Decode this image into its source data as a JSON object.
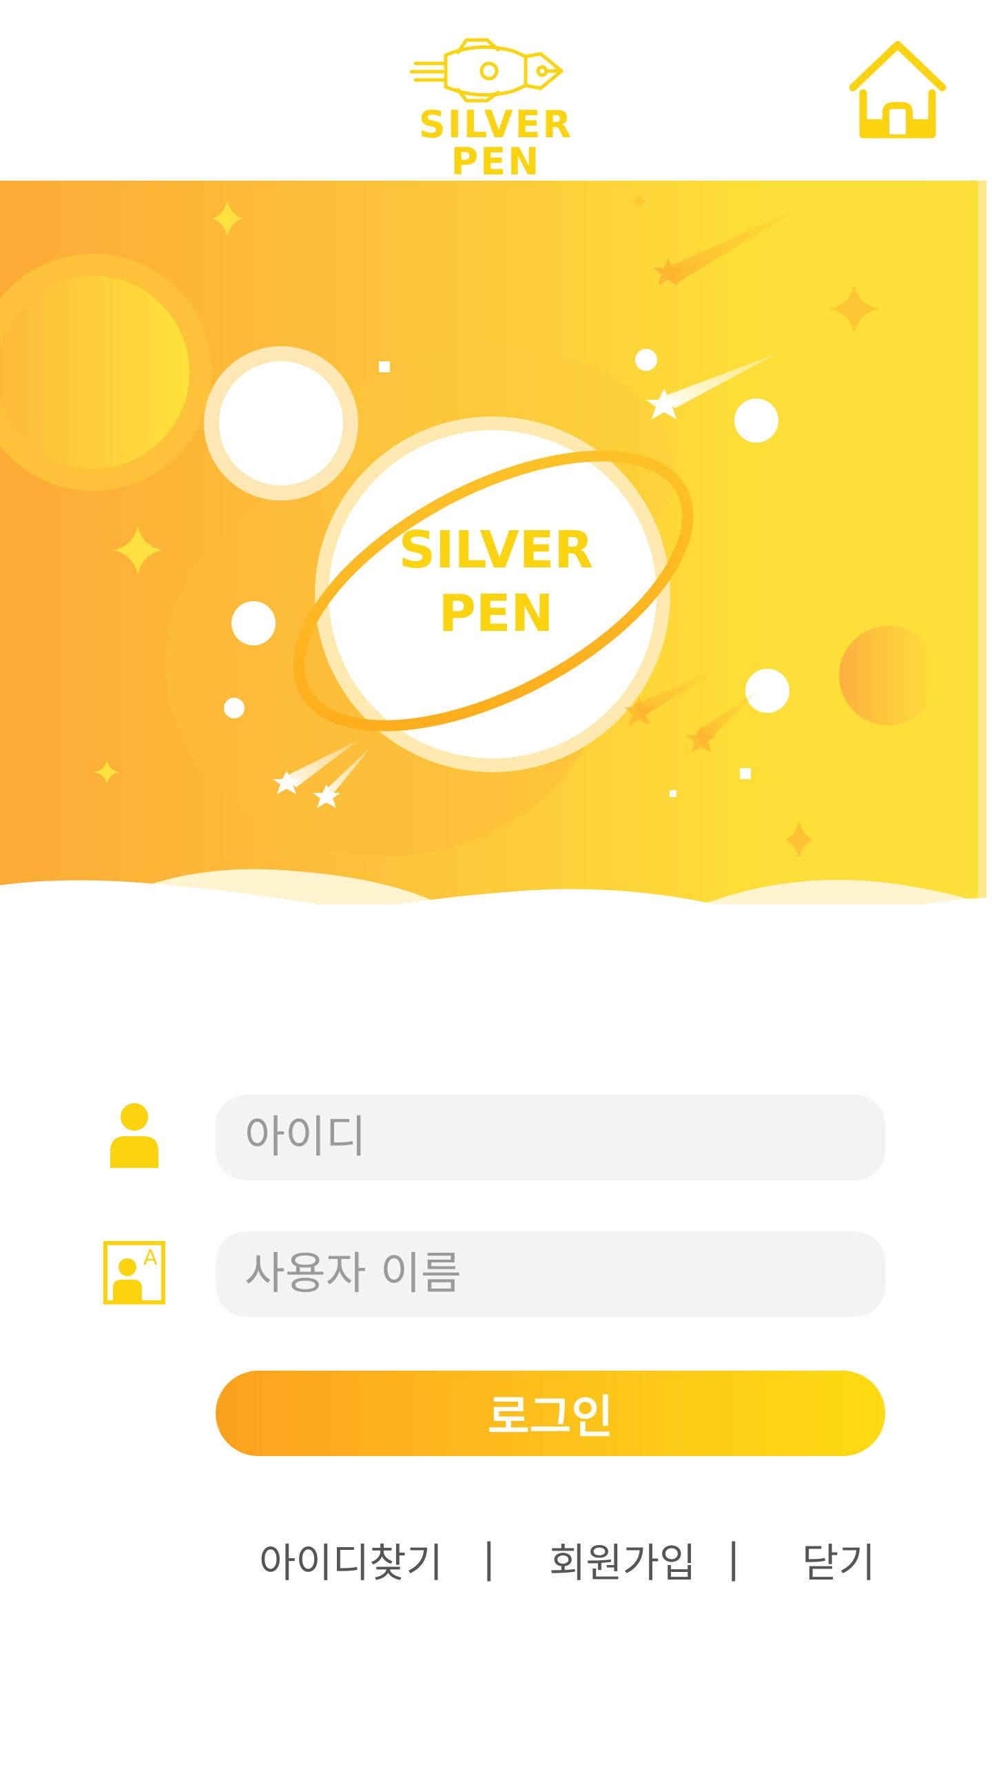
{
  "header": {
    "logo_text": "SILVER PEN",
    "home_icon": "home-icon"
  },
  "banner": {
    "title_line1": "SILVER",
    "title_line2": "PEN"
  },
  "form": {
    "id_field": {
      "placeholder": "아이디",
      "value": "",
      "icon": "user-icon"
    },
    "name_field": {
      "placeholder": "사용자 이름",
      "value": "",
      "icon": "user-name-card-icon"
    },
    "login_label": "로그인"
  },
  "links": {
    "find_id": "아이디찾기",
    "signup": "회원가입",
    "close": "닫기",
    "separator": "|"
  },
  "colors": {
    "brand_yellow": "#fcd30f",
    "brand_orange": "#fda11e",
    "field_bg": "#f3f3f3",
    "link_text": "#555555"
  }
}
